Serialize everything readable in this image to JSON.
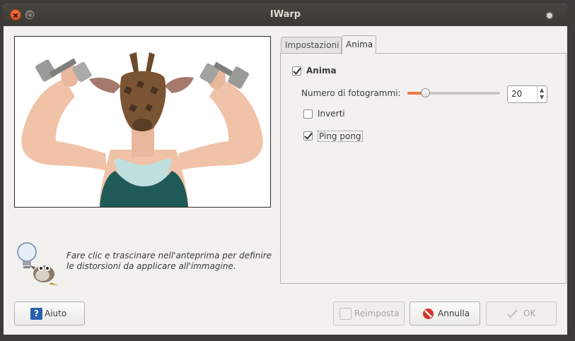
{
  "window": {
    "title": "IWarp"
  },
  "hint": {
    "text": "Fare clic e trascinare nell'anteprima per definire le distorsioni da applicare all'immagine."
  },
  "tabs": [
    {
      "label": "Impostazioni",
      "active": false
    },
    {
      "label": "Anima",
      "active": true
    }
  ],
  "anima": {
    "enable_label": "Anima",
    "enable_checked": true,
    "frames_label": "Numero di fotogrammi:",
    "frames_value": "20",
    "frames_fraction": 0.19,
    "invert_label": "Inverti",
    "invert_checked": false,
    "pingpong_label": "Ping pong",
    "pingpong_checked": true
  },
  "buttons": {
    "help": "Aiuto",
    "reset": "Reimposta",
    "cancel": "Annulla",
    "ok": "OK"
  },
  "colors": {
    "accent": "#f07746",
    "titlebar": "#3c3b37"
  }
}
